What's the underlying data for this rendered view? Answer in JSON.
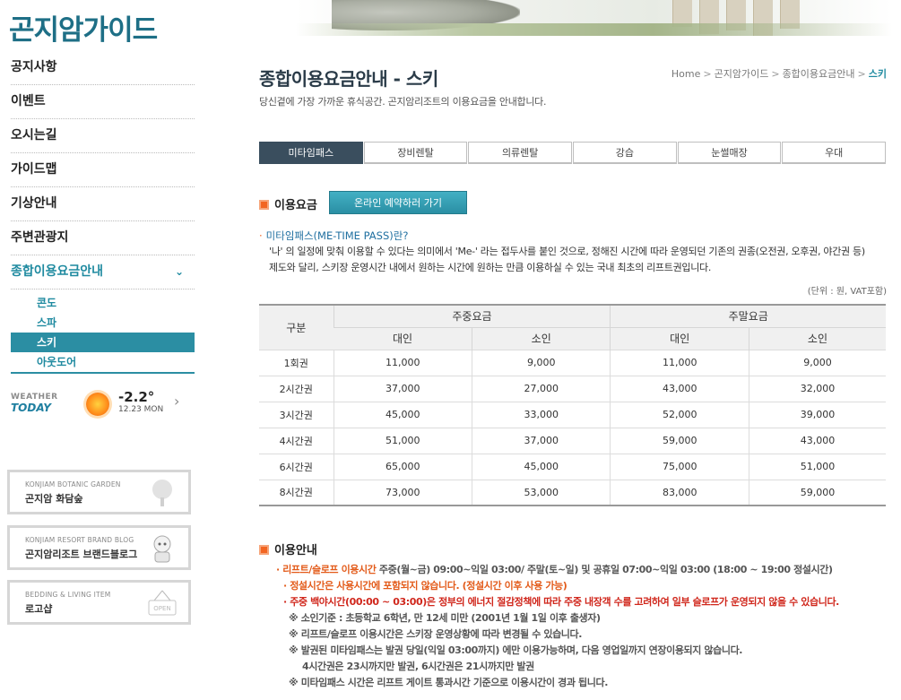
{
  "site": {
    "title": "곤지암가이드"
  },
  "nav": {
    "items": [
      "공지사항",
      "이벤트",
      "오시는길",
      "가이드맵",
      "기상안내",
      "주변관광지"
    ],
    "active_label": "종합이용요금안내",
    "active_chevron": "⌄",
    "sub_items": [
      "콘도",
      "스파",
      "스키",
      "아웃도어"
    ]
  },
  "weather": {
    "label_top": "WEATHER",
    "label_bottom": "TODAY",
    "icon": "sun-icon",
    "temp": "-2.2°",
    "date": "12.23 MON",
    "arrow": "›"
  },
  "side_banners": [
    {
      "en": "KONJIAM BOTANIC GARDEN",
      "ko": "곤지암 화담숲",
      "icon": "tree-icon"
    },
    {
      "en": "KONJIAM RESORT BRAND BLOG",
      "ko": "곤지암리조트 브랜드블로그",
      "icon": "character-icon"
    },
    {
      "en": "BEDDING & LIVING ITEM",
      "ko": "로고샵",
      "icon": "open-sign-icon"
    }
  ],
  "page": {
    "heading": "종합이용요금안내 - 스키",
    "description": "당신곁에 가장 가까운 휴식공간. 곤지암리조트의 이용요금을 안내합니다.",
    "breadcrumb": [
      "Home",
      "곤지암가이드",
      "종합이용요금안내",
      "스키"
    ]
  },
  "tabs": [
    "미타임패스",
    "장비렌탈",
    "의류렌탈",
    "강습",
    "눈썰매장",
    "우대"
  ],
  "fee_section": {
    "title": "이용요금",
    "book_button": "온라인 예약하러 가기",
    "question": "미타임패스(ME-TIME PASS)란?",
    "body_line1": "'나' 의 일정에 맞춰 이용할 수 있다는 의미에서 'Me-' 라는 접두사를 붙인 것으로, 정해진 시간에 따라 운영되던 기존의 권종(오전권, 오후권, 야간권 등)",
    "body_line2": "제도와 달리, 스키장 운영시간 내에서 원하는 시간에 원하는 만큼 이용하실 수 있는 국내 최초의 리프트권입니다.",
    "unit": "(단위 : 원, VAT포함)"
  },
  "table": {
    "col_type": "구분",
    "group_weekday": "주중요금",
    "group_weekend": "주말요금",
    "adult": "대인",
    "child": "소인",
    "rows": [
      [
        "1회권",
        "11,000",
        "9,000",
        "11,000",
        "9,000"
      ],
      [
        "2시간권",
        "37,000",
        "27,000",
        "43,000",
        "32,000"
      ],
      [
        "3시간권",
        "45,000",
        "33,000",
        "52,000",
        "39,000"
      ],
      [
        "4시간권",
        "51,000",
        "37,000",
        "59,000",
        "43,000"
      ],
      [
        "6시간권",
        "65,000",
        "45,000",
        "75,000",
        "51,000"
      ],
      [
        "8시간권",
        "73,000",
        "53,000",
        "83,000",
        "59,000"
      ]
    ]
  },
  "info_section": {
    "title": "이용안내",
    "hours_label": "· 리프트/슬로프 이용시간",
    "hours_text": " 주중(월~금) 09:00~익일 03:00/ 주말(토~일) 및 공휴일 07:00~익일 03:00  (18:00 ~ 19:00 정설시간)",
    "note1": "· 정설시간은 사용시간에 포함되지 않습니다. (정설시간 이후 사용 가능)",
    "note2": "· 주중 백야시간(00:00 ~ 03:00)은 정부의 에너지 절감정책에 따라 주중 내장객 수를 고려하여 일부 슬로프가 운영되지 않을 수 있습니다.",
    "note3": "※ 소인기준 : 초등학교 6학년, 만 12세 미만 (2001년 1월 1일 이후 출생자)",
    "note4": "※ 리프트/슬로프 이용시간은 스키장 운영상황에 따라 변경될 수 있습니다.",
    "note5": "※ 발권된 미타임패스는 발권 당일(익일 03:00까지) 에만 이용가능하며, 다음 영업일까지 연장이용되지 않습니다.",
    "note6": "4시간권은 23시까지만 발권, 6시간권은 21시까지만 발권",
    "note7": "※ 미타임패스 시간은 리프트 게이트 통과시간 기준으로 이용시간이 경과 됩니다."
  }
}
